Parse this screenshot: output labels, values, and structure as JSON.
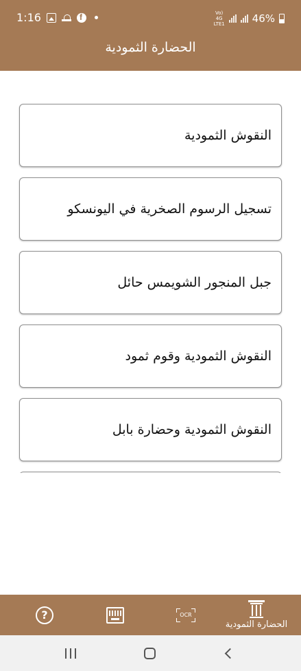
{
  "status_bar": {
    "time": "1:16",
    "network_top": "Vo) 4G",
    "network_bottom": "LTE1",
    "battery_percent": "46%"
  },
  "app": {
    "title": "الحضارة الثمودية"
  },
  "list": {
    "items": [
      {
        "label": "النقوش الثمودية"
      },
      {
        "label": "تسجيل الرسوم الصخرية في اليونسكو"
      },
      {
        "label": "جبل المنجور الشويمس حائل"
      },
      {
        "label": "النقوش الثمودية وقوم ثمود"
      },
      {
        "label": "النقوش الثمودية وحضارة بابل"
      },
      {
        "label": ""
      }
    ]
  },
  "bottom_nav": {
    "help_glyph": "?",
    "ocr_label": "OCR",
    "home_label": "الحضارة الثمودية"
  },
  "colors": {
    "brand": "#a57a55",
    "card_border": "#8f8f8f",
    "system_nav_bg": "#f1f1f1"
  },
  "icons": {
    "status": [
      "gallery-icon",
      "cloud-icon",
      "facebook-icon",
      "notification-dot-icon",
      "signal-icon",
      "battery-icon"
    ],
    "bottom_nav": [
      "help-icon",
      "keyboard-icon",
      "ocr-scan-icon",
      "pillar-icon"
    ],
    "system_nav": [
      "recents-icon",
      "home-icon",
      "back-icon"
    ]
  }
}
